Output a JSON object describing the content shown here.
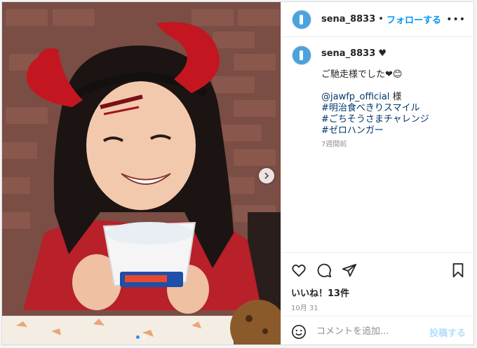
{
  "post": {
    "image_alt": "",
    "carousel_total": 2,
    "carousel_active": 0
  },
  "header": {
    "username": "sena_8833",
    "separator": "•",
    "follow_label": "フォローする",
    "more_label": "•••"
  },
  "caption": {
    "username": "sena_8833",
    "heart": "♥",
    "lines": [
      "ご馳走様でした❤😊"
    ],
    "mention": "@jawfp_official",
    "mention_suffix": " 様",
    "hashtags": [
      "#明治食べきりスマイル",
      "#ごちそうさまチャレンジ",
      "#ゼロハンガー"
    ],
    "time_ago": "7週間前"
  },
  "actions": {
    "like_icon": "heart-icon",
    "comment_icon": "comment-icon",
    "share_icon": "share-icon",
    "save_icon": "bookmark-icon",
    "likes_text": "いいね！13件",
    "date": "10月 31"
  },
  "comment_box": {
    "placeholder": "コメントを追加...",
    "post_label": "投稿する"
  },
  "colors": {
    "follow": "#0095f6",
    "post_disabled": "#b2dffc",
    "tag": "#00376b"
  }
}
